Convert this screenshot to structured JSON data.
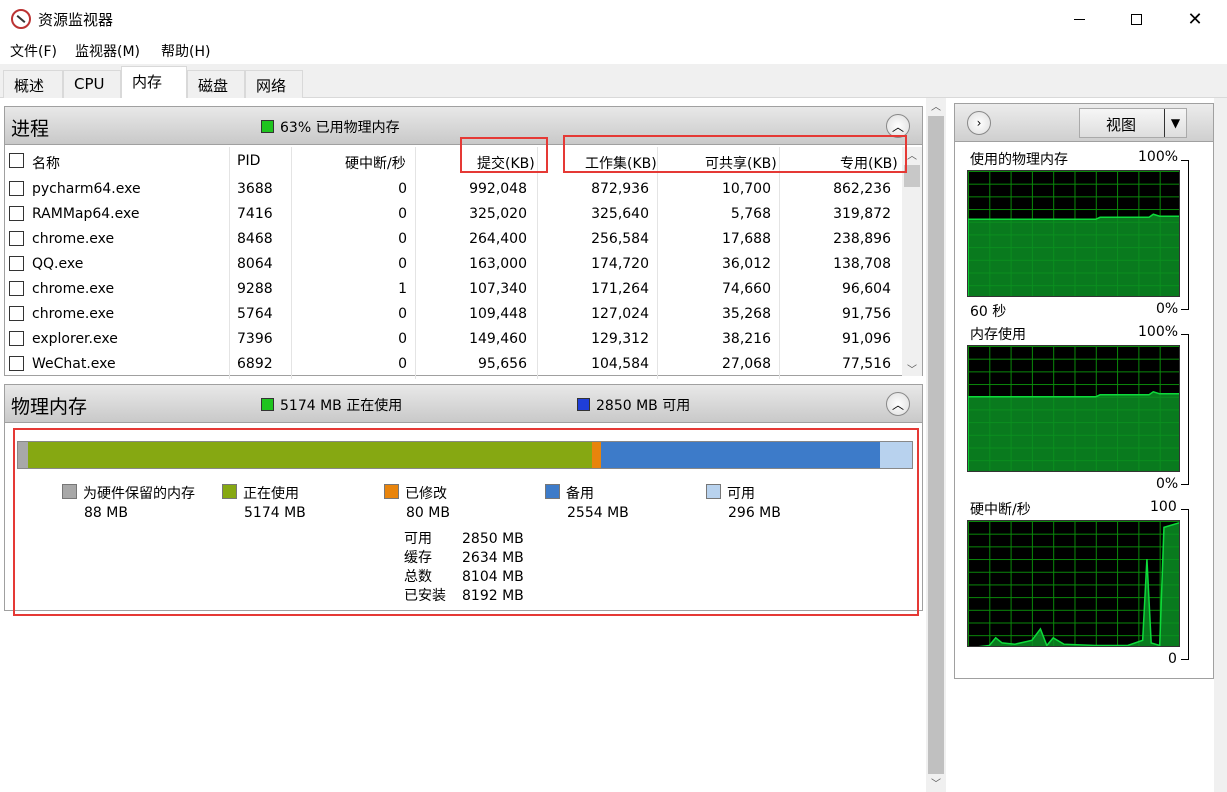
{
  "window": {
    "title": "资源监视器"
  },
  "menu": [
    "文件(F)",
    "监视器(M)",
    "帮助(H)"
  ],
  "tabs": [
    "概述",
    "CPU",
    "内存",
    "磁盘",
    "网络"
  ],
  "active_tab": "内存",
  "processes": {
    "title": "进程",
    "summary": "63% 已用物理内存",
    "columns": {
      "name": "名称",
      "pid": "PID",
      "hard_faults": "硬中断/秒",
      "commit": "提交(KB)",
      "working_set": "工作集(KB)",
      "shareable": "可共享(KB)",
      "private": "专用(KB)"
    },
    "rows": [
      {
        "name": "pycharm64.exe",
        "pid": "3688",
        "hard_faults": "0",
        "commit": "992,048",
        "working_set": "872,936",
        "shareable": "10,700",
        "private": "862,236"
      },
      {
        "name": "RAMMap64.exe",
        "pid": "7416",
        "hard_faults": "0",
        "commit": "325,020",
        "working_set": "325,640",
        "shareable": "5,768",
        "private": "319,872"
      },
      {
        "name": "chrome.exe",
        "pid": "8468",
        "hard_faults": "0",
        "commit": "264,400",
        "working_set": "256,584",
        "shareable": "17,688",
        "private": "238,896"
      },
      {
        "name": "QQ.exe",
        "pid": "8064",
        "hard_faults": "0",
        "commit": "163,000",
        "working_set": "174,720",
        "shareable": "36,012",
        "private": "138,708"
      },
      {
        "name": "chrome.exe",
        "pid": "9288",
        "hard_faults": "1",
        "commit": "107,340",
        "working_set": "171,264",
        "shareable": "74,660",
        "private": "96,604"
      },
      {
        "name": "chrome.exe",
        "pid": "5764",
        "hard_faults": "0",
        "commit": "109,448",
        "working_set": "127,024",
        "shareable": "35,268",
        "private": "91,756"
      },
      {
        "name": "explorer.exe",
        "pid": "7396",
        "hard_faults": "0",
        "commit": "149,460",
        "working_set": "129,312",
        "shareable": "38,216",
        "private": "91,096"
      },
      {
        "name": "WeChat.exe",
        "pid": "6892",
        "hard_faults": "0",
        "commit": "95,656",
        "working_set": "104,584",
        "shareable": "27,068",
        "private": "77,516"
      }
    ]
  },
  "physical_memory": {
    "title": "物理内存",
    "in_use_summary": "5174 MB 正在使用",
    "available_summary": "2850 MB 可用",
    "legend": [
      {
        "label": "为硬件保留的内存",
        "value": "88 MB",
        "color": "#a8a8a8"
      },
      {
        "label": "正在使用",
        "value": "5174 MB",
        "color": "#86a812"
      },
      {
        "label": "已修改",
        "value": "80 MB",
        "color": "#e8840c"
      },
      {
        "label": "备用",
        "value": "2554 MB",
        "color": "#3d7bc9"
      },
      {
        "label": "可用",
        "value": "296 MB",
        "color": "#b8d2ee"
      }
    ],
    "stats": [
      {
        "key": "可用",
        "value": "2850 MB"
      },
      {
        "key": "缓存",
        "value": "2634 MB"
      },
      {
        "key": "总数",
        "value": "8104 MB"
      },
      {
        "key": "已安装",
        "value": "8192 MB"
      }
    ]
  },
  "side_panel": {
    "view_label": "视图",
    "graphs": [
      {
        "title": "使用的物理内存",
        "max": "100%",
        "min": "0%",
        "time": "60 秒",
        "level": 0.62
      },
      {
        "title": "内存使用",
        "max": "100%",
        "min": "0%",
        "time": "",
        "level": 0.6
      },
      {
        "title": "硬中断/秒",
        "max": "100",
        "min": "0",
        "time": ""
      }
    ]
  },
  "colors": {
    "graph_line": "#0ddb3a",
    "graph_fill": "#0b8f23",
    "highlight_box": "#e53935"
  }
}
